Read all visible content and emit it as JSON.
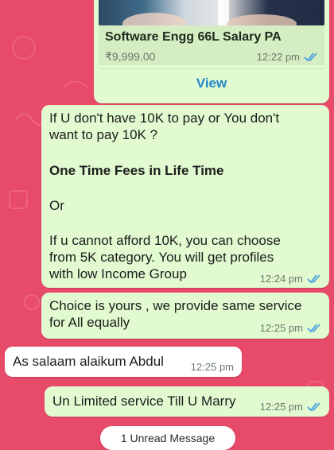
{
  "product": {
    "title": "Software Engg 66L Salary PA",
    "price": "₹9,999.00",
    "time": "12:22 pm",
    "view_label": "View"
  },
  "messages": [
    {
      "direction": "outgoing",
      "text": "If U don't have 10K to pay or You don't\nwant to pay 10K ?",
      "bold": "One Time Fees in Life Time",
      "text2": "Or",
      "text3": "If u cannot afford 10K, you can choose\nfrom 5K category. You will get profiles\nwith low Income Group",
      "time": "12:24 pm"
    },
    {
      "direction": "outgoing",
      "text": "Choice is yours , we provide same service\nfor All equally",
      "time": "12:25 pm"
    },
    {
      "direction": "incoming",
      "text": "As salaam alaikum Abdul",
      "time": "12:25 pm"
    },
    {
      "direction": "outgoing",
      "text": "Un Limited service Till U Marry",
      "time": "12:25 pm"
    }
  ],
  "unread_banner": "1 Unread Message",
  "colors": {
    "wallpaper": "#e84a6a",
    "outgoing_bubble": "#e1fad0",
    "incoming_bubble": "#ffffff",
    "read_tick": "#3b97e0",
    "link": "#2387c9"
  }
}
